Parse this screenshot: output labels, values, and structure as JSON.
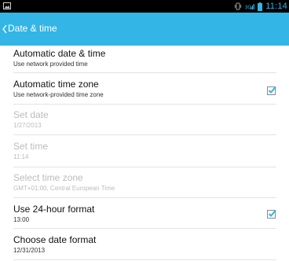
{
  "status_bar": {
    "time": "11:14",
    "icons": [
      "image-icon",
      "vibrate-icon",
      "signal-icon",
      "battery-icon"
    ],
    "accent_color": "#33b5e5"
  },
  "action_bar": {
    "title": "Date & time",
    "background_color": "#33b5e5"
  },
  "settings": [
    {
      "title": "Automatic date & time",
      "summary": "Use network provided time",
      "enabled": true,
      "checkbox": false,
      "checked": false
    },
    {
      "title": "Automatic time zone",
      "summary": "Use network-provided time zone",
      "enabled": true,
      "checkbox": true,
      "checked": true
    },
    {
      "title": "Set date",
      "summary": "1/27/2013",
      "enabled": false,
      "checkbox": false,
      "checked": false
    },
    {
      "title": "Set time",
      "summary": "11:14",
      "enabled": false,
      "checkbox": false,
      "checked": false
    },
    {
      "title": "Select time zone",
      "summary": "GMT+01:00, Central European Time",
      "enabled": false,
      "checkbox": false,
      "checked": false
    },
    {
      "title": "Use 24-hour format",
      "summary": "13:00",
      "enabled": true,
      "checkbox": true,
      "checked": true
    },
    {
      "title": "Choose date format",
      "summary": "12/31/2013",
      "enabled": true,
      "checkbox": false,
      "checked": false
    }
  ]
}
